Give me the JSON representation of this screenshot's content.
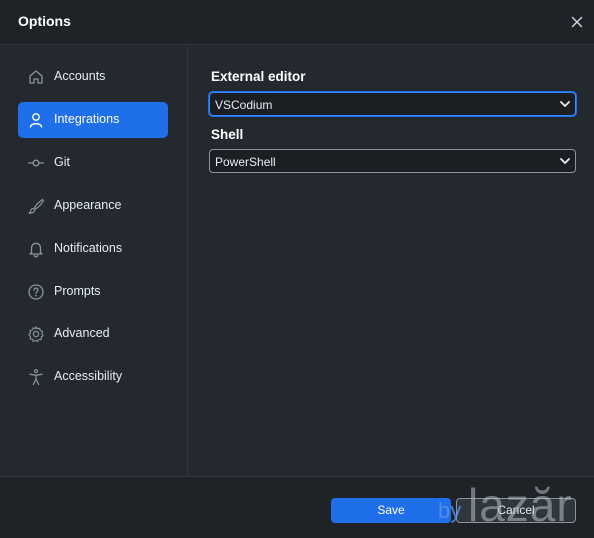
{
  "dialog": {
    "title": "Options"
  },
  "sidebar": {
    "items": [
      {
        "label": "Accounts",
        "icon": "home-icon",
        "active": false
      },
      {
        "label": "Integrations",
        "icon": "person-icon",
        "active": true
      },
      {
        "label": "Git",
        "icon": "git-commit-icon",
        "active": false
      },
      {
        "label": "Appearance",
        "icon": "paintbrush-icon",
        "active": false
      },
      {
        "label": "Notifications",
        "icon": "bell-icon",
        "active": false
      },
      {
        "label": "Prompts",
        "icon": "question-circle-icon",
        "active": false
      },
      {
        "label": "Advanced",
        "icon": "gear-icon",
        "active": false
      },
      {
        "label": "Accessibility",
        "icon": "accessibility-icon",
        "active": false
      }
    ]
  },
  "integrations": {
    "external_editor": {
      "label": "External editor",
      "value": "VSCodium"
    },
    "shell": {
      "label": "Shell",
      "value": "PowerShell"
    }
  },
  "footer": {
    "save_label": "Save",
    "cancel_label": "Cancel"
  },
  "watermark": {
    "by": "by",
    "brand": "lazăr"
  },
  "colors": {
    "accent": "#1f6feb",
    "background": "#24292f",
    "titlebar": "#1f2328"
  }
}
